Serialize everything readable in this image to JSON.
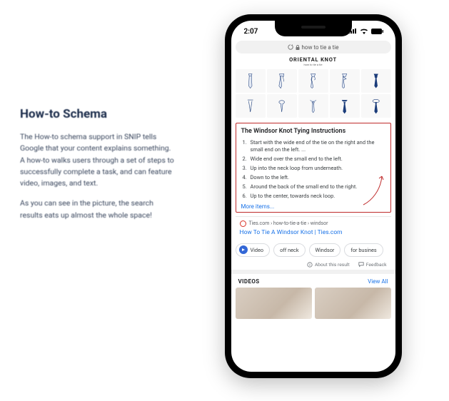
{
  "left": {
    "heading": "How-to Schema",
    "p1": "The How-to schema support in SNIP tells Google that your content explains something. A how-to walks users through a set of steps to successfully complete a task, and can feature video, images, and text.",
    "p2": "As you can see in the picture, the search results eats up almost the whole space!"
  },
  "phone": {
    "time": "2:07",
    "url_prefix": "🔒",
    "url": "how to tie a tie",
    "knot_header": "ORIENTAL KNOT",
    "knot_sub": "how to tie a tie",
    "result_title": "The Windsor Knot Tying Instructions",
    "steps": [
      "Start with the wide end of the tie on the right and the small end on the left. ...",
      "Wide end over the small end to the left.",
      "Up into the neck loop from underneath.",
      "Down to the left.",
      "Around the back of the small end to the right.",
      "Up to the center, towards neck loop."
    ],
    "more_items": "More items...",
    "source": "Ties.com › how-to-tie-a-tie › windsor",
    "result_link": "How To Tie A Windsor Knot | Ties.com",
    "chips": [
      "Video",
      "off neck",
      "Windsor",
      "for busines"
    ],
    "about": "About this result",
    "feedback": "Feedback",
    "videos_label": "VIDEOS",
    "view_all": "View All"
  }
}
